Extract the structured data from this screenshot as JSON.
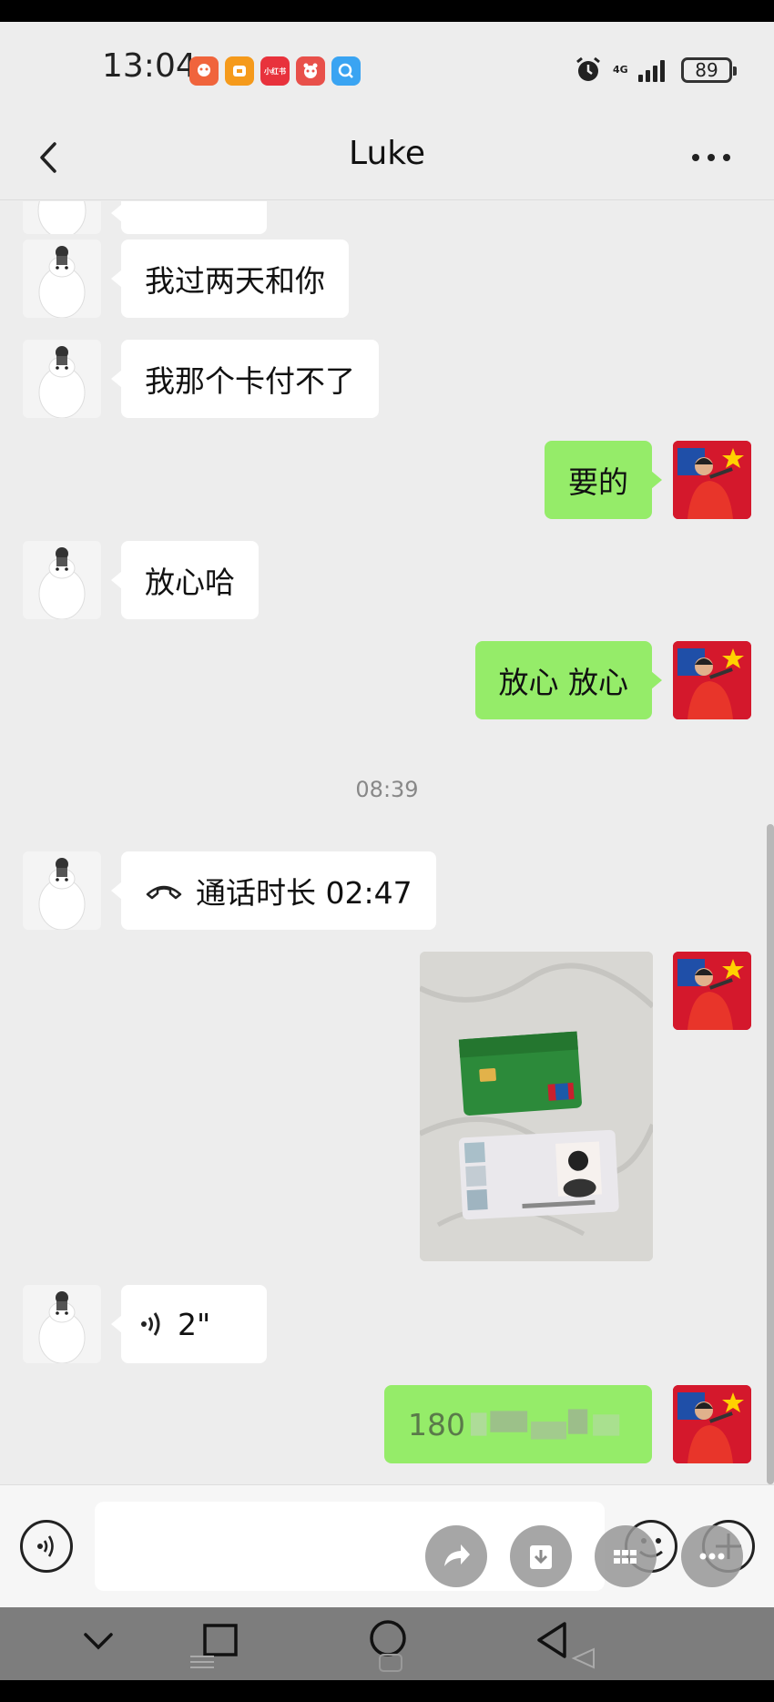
{
  "status_bar": {
    "time": "13:04",
    "notification_icons": [
      {
        "name": "app-icon-1",
        "color": "#f0643c"
      },
      {
        "name": "app-icon-2",
        "color": "#f59a1b"
      },
      {
        "name": "xiaohongshu-icon",
        "color": "#e8323c",
        "label": "小红书"
      },
      {
        "name": "app-icon-4",
        "color": "#e8504a"
      },
      {
        "name": "search-app-icon",
        "color": "#3aa4f2"
      }
    ],
    "network": "4G",
    "battery": "89"
  },
  "header": {
    "title": "Luke"
  },
  "messages": [
    {
      "side": "left",
      "type": "text",
      "text": "我过两天和你"
    },
    {
      "side": "left",
      "type": "text",
      "text": "我那个卡付不了"
    },
    {
      "side": "right",
      "type": "text",
      "text": "要的"
    },
    {
      "side": "left",
      "type": "text",
      "text": "放心哈"
    },
    {
      "side": "right",
      "type": "text",
      "text": "放心 放心"
    },
    {
      "type": "timestamp",
      "text": "08:39"
    },
    {
      "side": "left",
      "type": "call",
      "text": "通话时长 02:47"
    },
    {
      "side": "right",
      "type": "image",
      "description_icon": "photo-bank-card-and-id"
    },
    {
      "side": "left",
      "type": "voice",
      "text": "2\""
    },
    {
      "side": "right",
      "type": "text",
      "text": "180"
    }
  ],
  "colors": {
    "green_bubble": "#95ec69",
    "white_bubble": "#ffffff",
    "background": "#ededed"
  },
  "input_bar": {
    "value": ""
  }
}
